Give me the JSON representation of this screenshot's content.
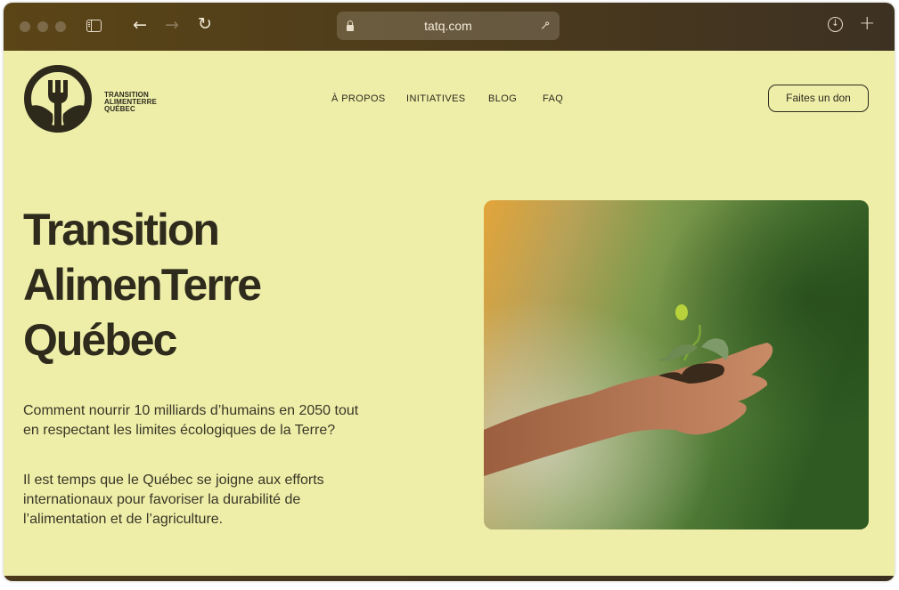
{
  "browser": {
    "url": "tatq.com"
  },
  "site": {
    "logo_lines": [
      "TRANSITION",
      "ALIMENTERRE",
      "QUÉBEC"
    ],
    "nav": {
      "apropos": "À PROPOS",
      "initiatives": "INITIATIVES",
      "blog": "BLOG",
      "faq": "FAQ"
    },
    "donate_label": "Faites un don"
  },
  "hero": {
    "title_lines": [
      "Transition",
      "AlimenTerre",
      "Québec"
    ],
    "paragraph1": "Comment nourrir 10 milliards d’humains en 2050 tout en respectant les limites écologiques de la Terre?",
    "paragraph2": "Il est temps que le Québec se joigne aux efforts internationaux pour favoriser la durabilité de l’alimentation et de l’agriculture."
  },
  "colors": {
    "page_background": "#eeeea9",
    "text_dark": "#2d2a1c",
    "titlebar": "#4e3c1b"
  }
}
